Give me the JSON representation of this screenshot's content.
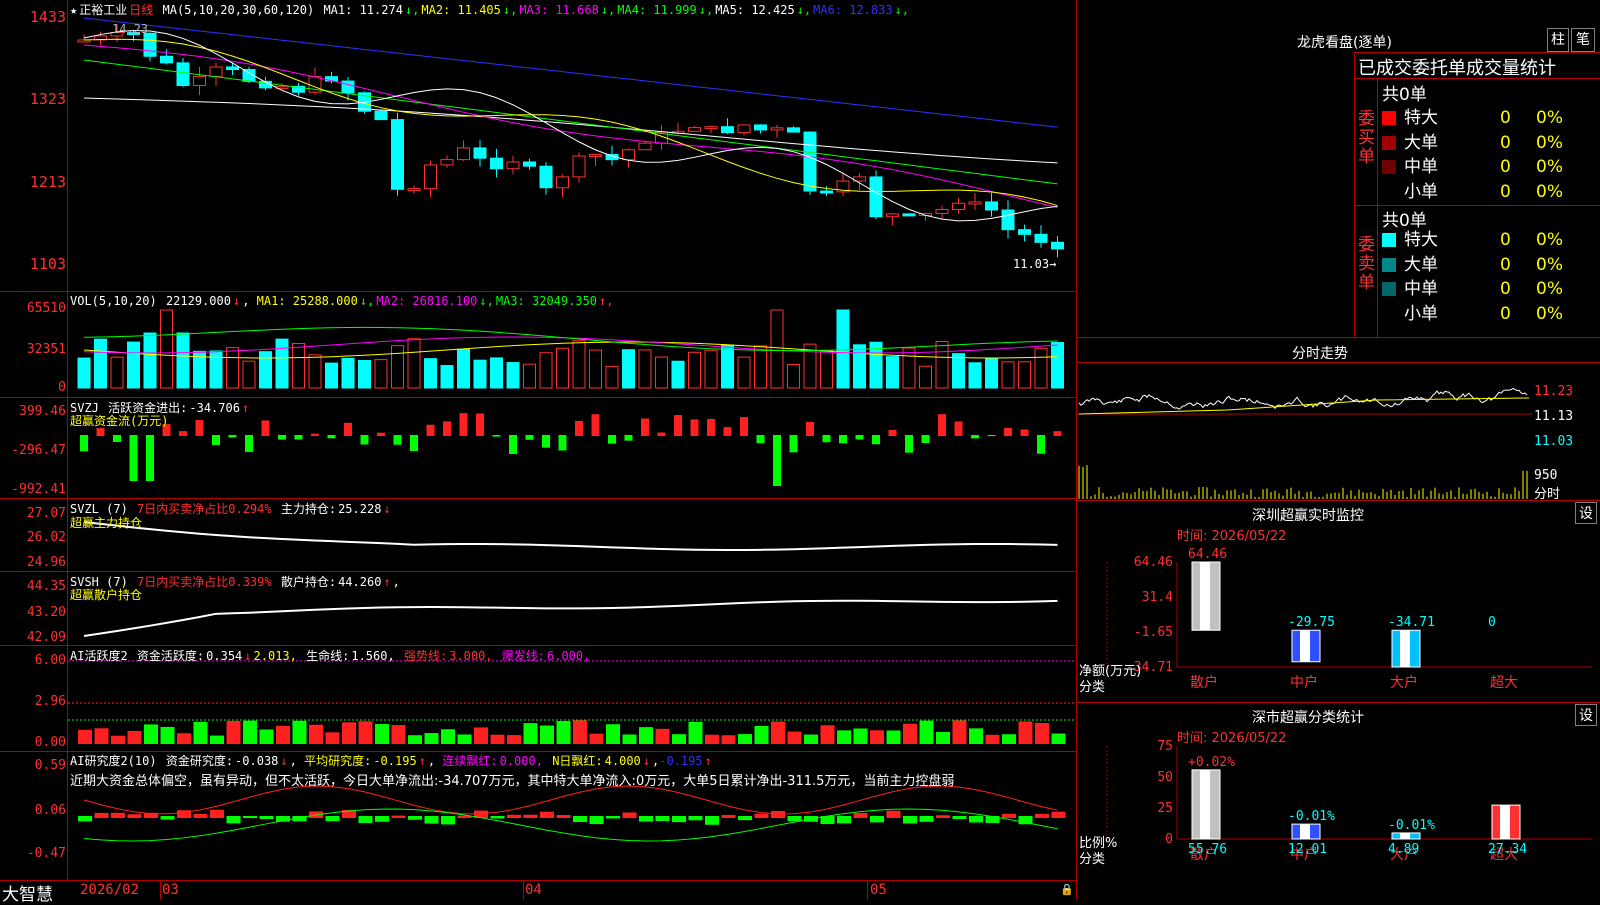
{
  "stock": {
    "name": "正裕工业",
    "period": "日线"
  },
  "main_chart": {
    "ma_label": "MA(5,10,20,30,60,120)",
    "ma": [
      {
        "label": "MA1:",
        "value": "11.274",
        "dir": "↓",
        "color": "#ffffff"
      },
      {
        "label": "MA2:",
        "value": "11.405",
        "dir": "↓",
        "color": "#ffff00"
      },
      {
        "label": "MA3:",
        "value": "11.668",
        "dir": "↓",
        "color": "#ff00ff"
      },
      {
        "label": "MA4:",
        "value": "11.999",
        "dir": "↓",
        "color": "#00ff00"
      },
      {
        "label": "MA5:",
        "value": "12.425",
        "dir": "↓",
        "color": "#ffffff"
      },
      {
        "label": "MA6:",
        "value": "12.833",
        "dir": "↓",
        "color": "#3030ff"
      }
    ],
    "y_ticks": [
      "1433",
      "1323",
      "1213",
      "1103"
    ],
    "high_label": "14.23",
    "low_label": "11.03→"
  },
  "vol_panel": {
    "title": "VOL(5,10,20)",
    "value": "22129.000",
    "value_dir": "↓",
    "ma": [
      {
        "label": "MA1:",
        "value": "25288.000",
        "dir": "↓",
        "color": "#ffff00"
      },
      {
        "label": "MA2:",
        "value": "26816.100",
        "dir": "↓",
        "color": "#ff00ff"
      },
      {
        "label": "MA3:",
        "value": "32049.350",
        "dir": "↑",
        "color": "#00ff00"
      }
    ],
    "y_ticks": [
      "65510",
      "32351",
      "0"
    ]
  },
  "svzj_panel": {
    "title": "SVZJ",
    "line1_label": "活跃资金进出:",
    "line1_value": "-34.706",
    "line1_dir": "↑",
    "subtitle": "超赢资金流(万元)",
    "y_ticks": [
      "399.46",
      "-296.47",
      "-992.41"
    ]
  },
  "svzl_panel": {
    "title": "SVZL (7)",
    "label1": "7日内买卖净占比0.294%",
    "label2": "主力持仓:",
    "value2": "25.228",
    "dir2": "↓",
    "subtitle": "超赢主力持仓",
    "y_ticks": [
      "27.07",
      "26.02",
      "24.96"
    ]
  },
  "svsh_panel": {
    "title": "SVSH (7)",
    "label1": "7日内买卖净占比0.339%",
    "label2": "散户持仓:",
    "value2": "44.260",
    "dir2": "↑",
    "tail": ",",
    "subtitle": "超赢散户持仓",
    "y_ticks": [
      "44.35",
      "43.20",
      "42.09"
    ]
  },
  "ai_activity": {
    "title": "AI活跃度2",
    "label1": "资金活跃度:",
    "value1": "0.354",
    "dir1": "↓",
    "value1b": "2.013,",
    "label2": "生命线:",
    "value2": "1.560,",
    "label3": "强势线:",
    "value3": "3.000,",
    "label4": "爆发线:",
    "value4": "6.000,",
    "y_ticks": [
      "6.00",
      "2.96",
      "0.00"
    ]
  },
  "ai_research": {
    "title": "AI研究度2(10)",
    "label1": "资金研究度:",
    "value1": "-0.038",
    "dir1": "↓",
    "label2": "平均研究度:",
    "value2": "-0.195",
    "dir2": "↑",
    "label3": "连续飘红:",
    "value3": "0.000,",
    "label4": "N日飘红:",
    "value4": "4.000",
    "dir4": "↓",
    "value5": "-0.195",
    "dir5": "↑",
    "comment": "近期大资金总体偏空，虽有异动，但不太活跃，今日大单净流出:-34.707万元，其中特大单净流入:0万元，大单5日累计净出-311.5万元，当前主力控盘弱",
    "y_ticks": [
      "0.59",
      "0.06",
      "-0.47"
    ]
  },
  "x_axis": {
    "brand": "大智慧",
    "labels": [
      "2026/02",
      "03",
      "04",
      "05"
    ]
  },
  "right": {
    "dragon_title": "龙虎看盘(逐单)",
    "btn_zhu": "柱",
    "btn_bi": "笔",
    "order_header": "已成交委托单成交量统计",
    "buy_side_label": "委买单",
    "sell_side_label": "委卖单",
    "buy_total": "共0单",
    "sell_total": "共0单",
    "buy_rows": [
      {
        "name": "特大",
        "count": "0",
        "pct": "0%",
        "color": "#ff0000"
      },
      {
        "name": "大单",
        "count": "0",
        "pct": "0%",
        "color": "#a00000"
      },
      {
        "name": "中单",
        "count": "0",
        "pct": "0%",
        "color": "#700000"
      },
      {
        "name": "小单",
        "count": "0",
        "pct": "0%",
        "color": "#000000"
      }
    ],
    "sell_rows": [
      {
        "name": "特大",
        "count": "0",
        "pct": "0%",
        "color": "#00ffff"
      },
      {
        "name": "大单",
        "count": "0",
        "pct": "0%",
        "color": "#008888"
      },
      {
        "name": "中单",
        "count": "0",
        "pct": "0%",
        "color": "#006868"
      },
      {
        "name": "小单",
        "count": "0",
        "pct": "0%",
        "color": "#000000"
      }
    ],
    "intraday_title": "分时走势",
    "intraday_ticks": [
      "11.23",
      "11.13",
      "11.03"
    ],
    "intraday_vol": [
      "950",
      "分时"
    ],
    "sz_monitor": {
      "title": "深圳超赢实时监控",
      "set_btn": "设",
      "time_label": "时间: 2026/05/22",
      "y_ticks": [
        "64.46",
        "31.4",
        "-1.65",
        "-34.71"
      ],
      "ylabel": "净额(万元)",
      "xlabel": "分类",
      "categories": [
        "散户",
        "中户",
        "大户",
        "超大"
      ],
      "values_text": [
        "64.46",
        "-29.75",
        "-34.71",
        "0"
      ]
    },
    "sz_class": {
      "title": "深市超赢分类统计",
      "set_btn": "设",
      "time_label": "时间: 2026/05/22",
      "y_ticks": [
        "75",
        "50",
        "25",
        "0"
      ],
      "ylabel": "比例%",
      "xlabel": "分类",
      "categories": [
        "散户",
        "中户",
        "大户",
        "超大"
      ],
      "top_text": [
        "+0.02%",
        "-0.01%",
        "-0.01%",
        ""
      ],
      "bottom_text": [
        "55.76",
        "12.01",
        "4.89",
        "27.34"
      ]
    }
  },
  "chart_data": [
    {
      "type": "bar",
      "title": "深圳超赢实时监控",
      "categories": [
        "散户",
        "中户",
        "大户",
        "超大"
      ],
      "values": [
        64.46,
        -29.75,
        -34.71,
        0
      ],
      "ylabel": "净额(万元)",
      "xlabel": "分类",
      "ylim": [
        -34.71,
        64.46
      ]
    },
    {
      "type": "bar",
      "title": "深市超赢分类统计",
      "categories": [
        "散户",
        "中户",
        "大户",
        "超大"
      ],
      "values": [
        55.76,
        12.01,
        4.89,
        27.34
      ],
      "ylabel": "比例%",
      "xlabel": "分类",
      "ylim": [
        0,
        75
      ]
    }
  ]
}
